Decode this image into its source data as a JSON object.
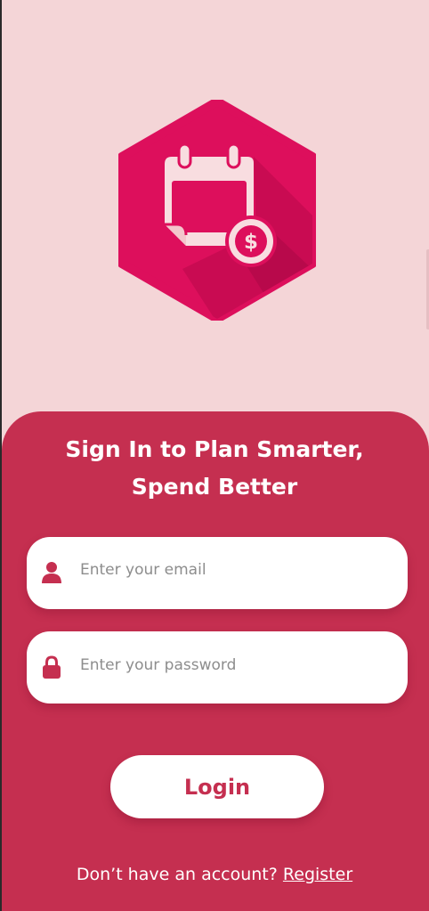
{
  "colors": {
    "background": "#f4d5d7",
    "accent": "#c52f50",
    "logo": "#dd0f5c",
    "white": "#ffffff"
  },
  "logo": {
    "icon": "calendar-dollar-icon"
  },
  "form": {
    "title_line1": "Sign In to Plan Smarter,",
    "title_line2": "Spend Better",
    "email": {
      "icon": "user-icon",
      "placeholder": "Enter your email",
      "value": ""
    },
    "password": {
      "icon": "lock-icon",
      "placeholder": "Enter your password",
      "value": ""
    },
    "login_label": "Login"
  },
  "footer": {
    "prompt": "Don’t have an account?",
    "register_label": "Register"
  }
}
